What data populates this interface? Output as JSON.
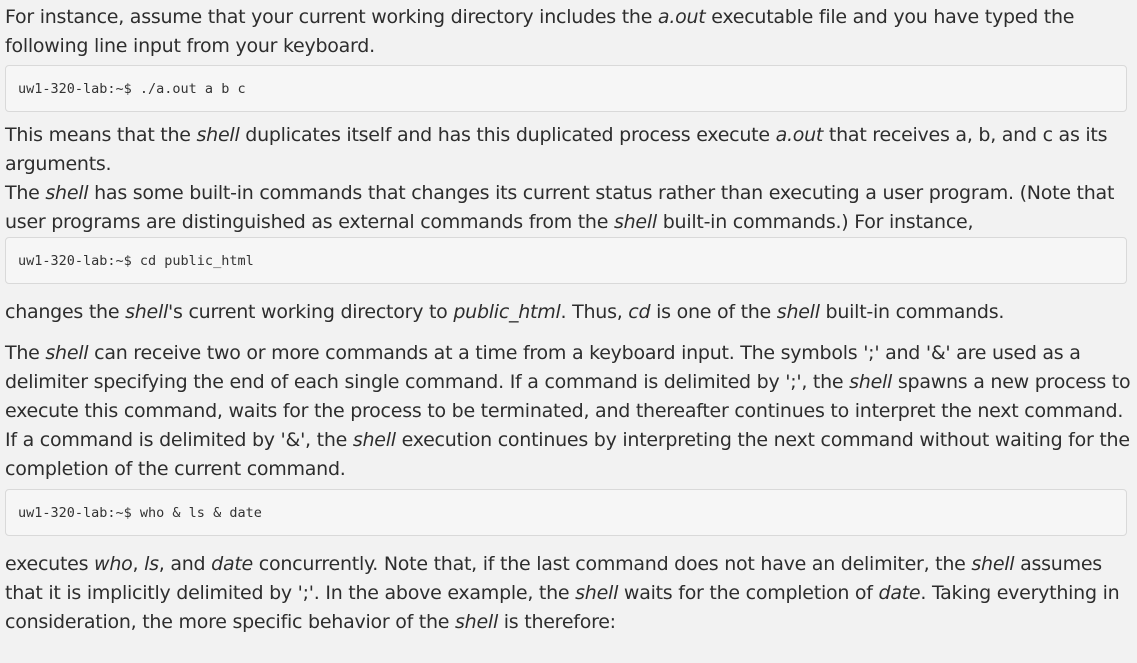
{
  "paragraphs": {
    "p1": [
      {
        "t": "For instance, assume that your current working directory includes the "
      },
      {
        "t": "a.out",
        "i": true
      },
      {
        "t": " executable file and you have typed the following line input from your keyboard."
      }
    ],
    "p2": [
      {
        "t": "This means that the "
      },
      {
        "t": "shell",
        "i": true
      },
      {
        "t": " duplicates itself and has this duplicated process execute "
      },
      {
        "t": "a.out",
        "i": true
      },
      {
        "t": " that receives a, b, and c as its arguments."
      }
    ],
    "p3": [
      {
        "t": "The "
      },
      {
        "t": "shell",
        "i": true
      },
      {
        "t": " has some built-in commands that changes its current status rather than executing a user program. (Note that user programs are distinguished as external commands from the "
      },
      {
        "t": "shell",
        "i": true
      },
      {
        "t": " built-in commands.) For instance,"
      }
    ],
    "p4": [
      {
        "t": "changes the "
      },
      {
        "t": "shell",
        "i": true
      },
      {
        "t": "'s current working directory to "
      },
      {
        "t": "public_html",
        "i": true
      },
      {
        "t": ". Thus, "
      },
      {
        "t": "cd",
        "i": true
      },
      {
        "t": " is one of the "
      },
      {
        "t": "shell",
        "i": true
      },
      {
        "t": " built-in commands."
      }
    ],
    "p5": [
      {
        "t": "The "
      },
      {
        "t": "shell",
        "i": true
      },
      {
        "t": " can receive two or more commands at a time from a keyboard input. The symbols ';' and '&' are used as a delimiter specifying the end of each single command. If a command is delimited by ';', the "
      },
      {
        "t": "shell",
        "i": true
      },
      {
        "t": " spawns a new process to execute this command, waits for the process to be terminated, and thereafter continues to interpret the next command. If a command is delimited by '&', the "
      },
      {
        "t": "shell",
        "i": true
      },
      {
        "t": " execution continues by interpreting the next command without waiting for the completion of the current command."
      }
    ],
    "p6": [
      {
        "t": "executes "
      },
      {
        "t": "who",
        "i": true
      },
      {
        "t": ", "
      },
      {
        "t": "ls",
        "i": true
      },
      {
        "t": ", and "
      },
      {
        "t": "date",
        "i": true
      },
      {
        "t": " concurrently. Note that, if the last command does not have an delimiter, the "
      },
      {
        "t": "shell",
        "i": true
      },
      {
        "t": " assumes that it is implicitly delimited by ';'. In the above example, the "
      },
      {
        "t": "shell",
        "i": true
      },
      {
        "t": " waits for the completion of "
      },
      {
        "t": "date",
        "i": true
      },
      {
        "t": ". Taking everything in consideration, the more specific behavior of the "
      },
      {
        "t": "shell",
        "i": true
      },
      {
        "t": " is therefore:"
      }
    ]
  },
  "code": {
    "c1": "uw1-320-lab:~$ ./a.out a b c",
    "c2": "uw1-320-lab:~$ cd public_html",
    "c3": "uw1-320-lab:~$ who & ls & date"
  }
}
